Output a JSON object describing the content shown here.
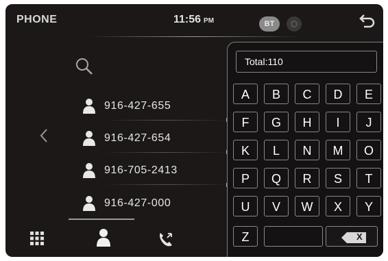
{
  "header": {
    "title": "PHONE",
    "time": "11:56",
    "ampm": "PM",
    "bt_label": "BT"
  },
  "icons": {
    "search": "search-icon",
    "back": "back-icon",
    "settings": "gear-icon",
    "left": "chevron-left-icon",
    "person": "person-icon",
    "dialpad": "dialpad-icon",
    "contacts": "contacts-icon",
    "calls": "phone-calls-icon",
    "backspace": "backspace-icon"
  },
  "contacts": [
    {
      "number": "916-427-655"
    },
    {
      "number": "916-427-654"
    },
    {
      "number": "916-705-2413"
    },
    {
      "number": "916-427-000"
    }
  ],
  "panel": {
    "total_label": "Total:110",
    "keys": [
      "A",
      "B",
      "C",
      "D",
      "E",
      "F",
      "G",
      "H",
      "I",
      "J",
      "K",
      "L",
      "N",
      "M",
      "O",
      "P",
      "Q",
      "R",
      "S",
      "T",
      "U",
      "V",
      "W",
      "X",
      "Y",
      "Z"
    ],
    "backspace_label": "X"
  }
}
